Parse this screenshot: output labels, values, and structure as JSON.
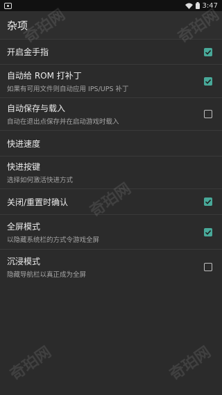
{
  "status_bar": {
    "time": "3:47"
  },
  "app_bar": {
    "title": "杂项"
  },
  "settings": [
    {
      "title": "开启金手指",
      "subtitle": "",
      "checkbox": "checked"
    },
    {
      "title": "自动给 ROM 打补丁",
      "subtitle": "如果有可用文件则自动应用 IPS/UPS 补丁",
      "checkbox": "checked"
    },
    {
      "title": "自动保存与载入",
      "subtitle": "自动在退出点保存并在启动游戏时载入",
      "checkbox": "unchecked"
    },
    {
      "title": "快进速度",
      "subtitle": "",
      "checkbox": "none"
    },
    {
      "title": "快进按键",
      "subtitle": "选择如何激活快进方式",
      "checkbox": "none"
    },
    {
      "title": "关闭/重置时确认",
      "subtitle": "",
      "checkbox": "checked"
    },
    {
      "title": "全屏模式",
      "subtitle": "以隐藏系统栏的方式令游戏全屏",
      "checkbox": "checked"
    },
    {
      "title": "沉浸模式",
      "subtitle": "隐藏导航栏以真正成为全屏",
      "checkbox": "unchecked"
    }
  ],
  "watermark": {
    "text": "奇珀网"
  },
  "colors": {
    "accent": "#48a999",
    "background": "#2b2b2b"
  },
  "icons": {
    "status_app": "app-notification-icon",
    "wifi": "wifi-icon",
    "battery": "battery-icon",
    "check": "checkmark-icon"
  }
}
